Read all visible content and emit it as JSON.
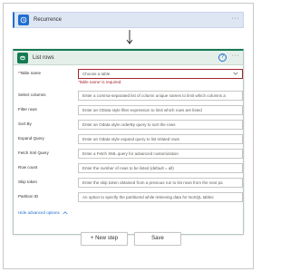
{
  "recurrence": {
    "title": "Recurrence",
    "more": "···"
  },
  "list_rows": {
    "title": "List rows",
    "help": "?",
    "more": "···",
    "error_message": "'Table name' is required.",
    "fields": [
      {
        "label": "Table name",
        "required_mark": "*",
        "placeholder": "Choose a table"
      },
      {
        "label": "Select columns",
        "placeholder": "Enter a comma-separated list of column unique names to limit which columns a"
      },
      {
        "label": "Filter rows",
        "placeholder": "Enter an OData style filter expression to limit which rows are listed"
      },
      {
        "label": "Sort By",
        "placeholder": "Enter an Odata style orderBy query to sort the rows"
      },
      {
        "label": "Expand Query",
        "placeholder": "Enter an Odata style expand query to list related rows"
      },
      {
        "label": "Fetch Xml Query",
        "placeholder": "Enter a Fetch XML query for advanced customization"
      },
      {
        "label": "Row count",
        "placeholder": "Enter the number of rows to be listed (default = all)"
      },
      {
        "label": "Skip token",
        "placeholder": "Enter the skip token obtained from a previous run to list rows from the next pa"
      },
      {
        "label": "Partition ID",
        "placeholder": "An option to specify the partitionId while retrieving data for NoSQL tables"
      }
    ],
    "advanced_toggle": "Hide advanced options"
  },
  "buttons": {
    "new_step": "+ New step",
    "save": "Save"
  },
  "colors": {
    "recurrence_accent": "#1f6fd1",
    "dataverse_accent": "#137a52",
    "error": "#a4262c"
  }
}
